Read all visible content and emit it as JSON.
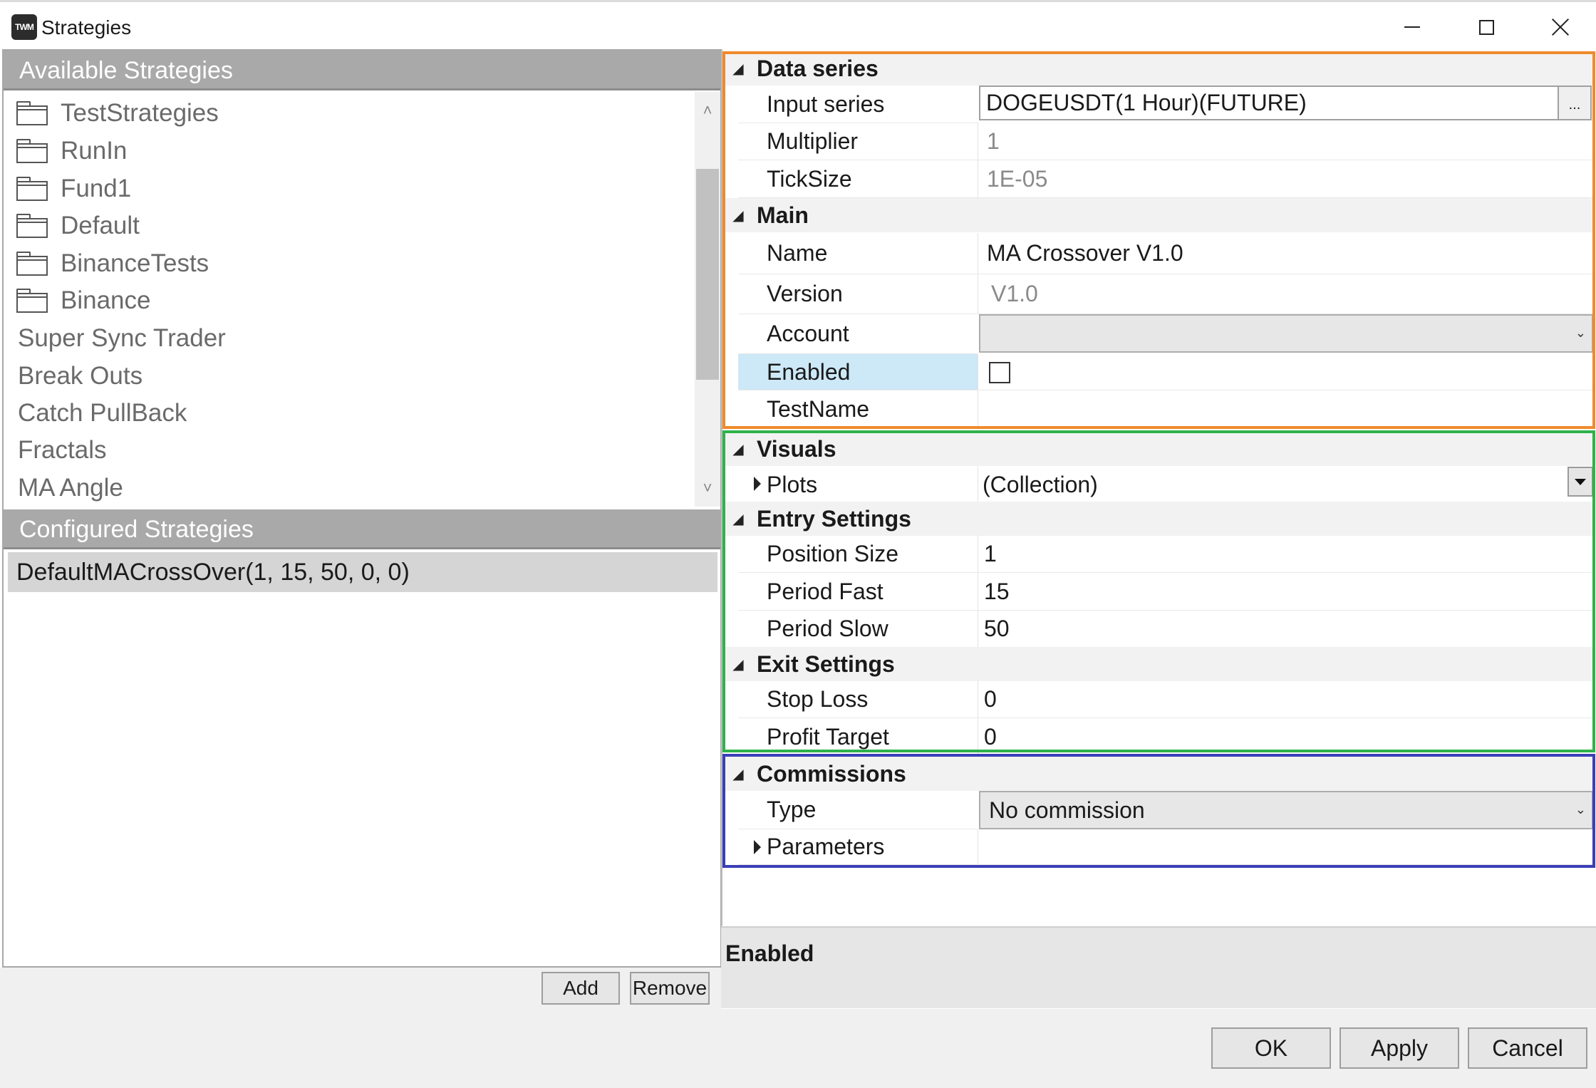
{
  "window": {
    "logo_text": "TWM",
    "title": "Strategies"
  },
  "left": {
    "available_header": "Available Strategies",
    "folders": [
      "TestStrategies",
      "RunIn",
      "Fund1",
      "Default",
      "BinanceTests",
      "Binance"
    ],
    "strategies": [
      "Super Sync Trader",
      "Break Outs",
      "Catch PullBack",
      "Fractals",
      "MA Angle"
    ],
    "configured_header": "Configured Strategies",
    "configured_items": [
      "DefaultMACrossOver(1, 15, 50, 0, 0)"
    ],
    "add_label": "Add",
    "remove_label": "Remove"
  },
  "properties": {
    "data_series": {
      "label": "Data series",
      "input_series_label": "Input series",
      "input_series_value": "DOGEUSDT(1 Hour)(FUTURE)",
      "ellipsis": "...",
      "multiplier_label": "Multiplier",
      "multiplier_value": "1",
      "ticksize_label": "TickSize",
      "ticksize_value": "1E-05"
    },
    "main": {
      "label": "Main",
      "name_label": "Name",
      "name_value": "MA Crossover V1.0",
      "version_label": "Version",
      "version_value": "V1.0",
      "account_label": "Account",
      "account_value": "",
      "enabled_label": "Enabled",
      "enabled_checked": false,
      "testname_label": "TestName",
      "testname_value": ""
    },
    "visuals": {
      "label": "Visuals",
      "plots_label": "Plots",
      "plots_value": "(Collection)"
    },
    "entry": {
      "label": "Entry Settings",
      "position_size_label": "Position Size",
      "position_size_value": "1",
      "period_fast_label": "Period Fast",
      "period_fast_value": "15",
      "period_slow_label": "Period Slow",
      "period_slow_value": "50"
    },
    "exit": {
      "label": "Exit Settings",
      "stop_loss_label": "Stop Loss",
      "stop_loss_value": "0",
      "profit_target_label": "Profit Target",
      "profit_target_value": "0"
    },
    "commissions": {
      "label": "Commissions",
      "type_label": "Type",
      "type_value": "No commission",
      "parameters_label": "Parameters"
    }
  },
  "description": {
    "title": "Enabled"
  },
  "footer": {
    "ok_label": "OK",
    "apply_label": "Apply",
    "cancel_label": "Cancel"
  },
  "colors": {
    "highlight_orange": "#f08a2c",
    "highlight_green": "#2fb24b",
    "highlight_blue": "#3a3fb6",
    "selected_row": "#cde8f7"
  }
}
